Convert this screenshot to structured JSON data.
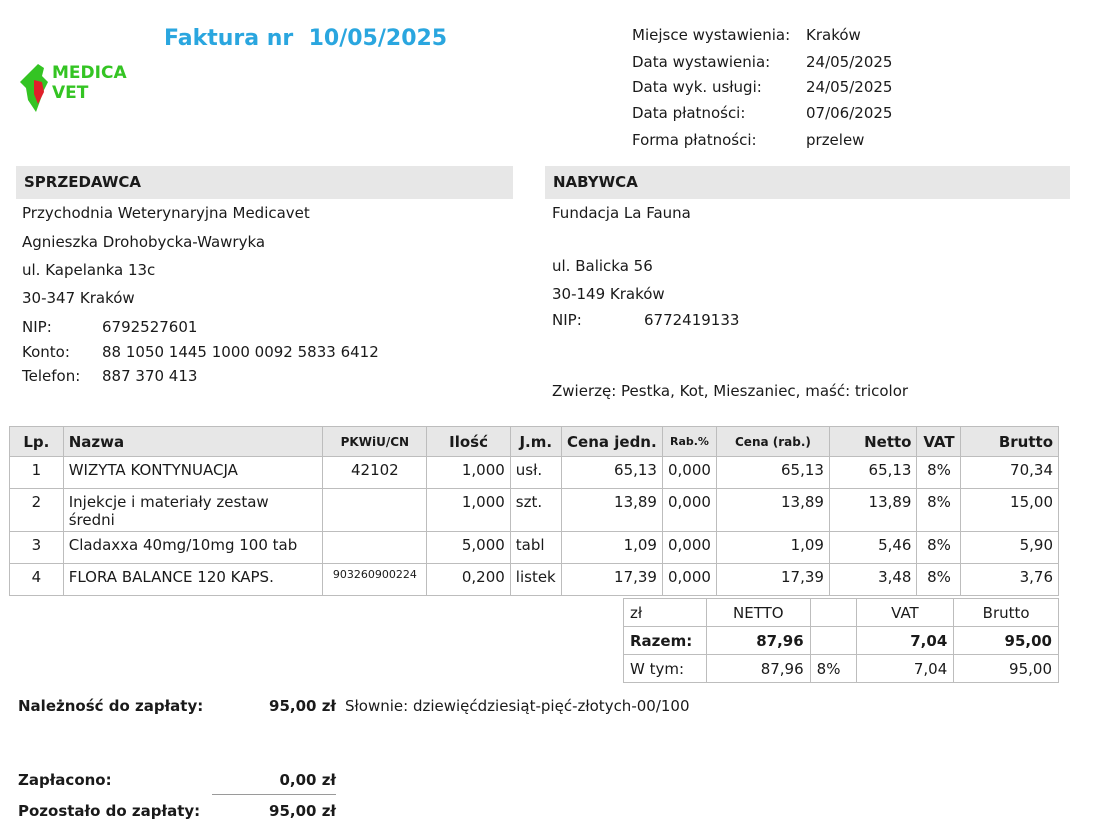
{
  "invoice": {
    "title": "Faktura nr  10/05/2025"
  },
  "logo": {
    "line1": "MEDICA",
    "line2": "VET"
  },
  "meta": [
    {
      "label": "Miejsce wystawienia:",
      "value": "Kraków"
    },
    {
      "label": "Data wystawienia:",
      "value": "24/05/2025"
    },
    {
      "label": "Data wyk. usługi:",
      "value": "24/05/2025"
    },
    {
      "label": "Data płatności:",
      "value": "07/06/2025"
    },
    {
      "label": "Forma płatności:",
      "value": "przelew"
    }
  ],
  "seller": {
    "heading": "SPRZEDAWCA",
    "name": "Przychodnia Weterynaryjna Medicavet",
    "person": "Agnieszka Drohobycka-Wawryka",
    "street": "ul. Kapelanka 13c",
    "city": "30-347 Kraków",
    "nip_label": "NIP:",
    "nip": "6792527601",
    "konto_label": "Konto:",
    "konto": "88 1050 1445 1000 0092 5833 6412",
    "tel_label": "Telefon:",
    "tel": "887 370 413"
  },
  "buyer": {
    "heading": "NABYWCA",
    "name": "Fundacja La Fauna",
    "street": "ul. Balicka 56",
    "city": "30-149 Kraków",
    "nip_label": "NIP:",
    "nip": "6772419133",
    "animal": "Zwierzę: Pestka, Kot, Mieszaniec, maść: tricolor"
  },
  "items_table": {
    "headers": [
      "Lp.",
      "Nazwa",
      "PKWiU/CN",
      "Ilość",
      "J.m.",
      "Cena jedn.",
      "Rab.%",
      "Cena (rab.)",
      "Netto",
      "VAT",
      "Brutto"
    ],
    "rows": [
      [
        "1",
        "WIZYTA KONTYNUACJA",
        "42102",
        "1,000",
        "usł.",
        "65,13",
        "0,000",
        "65,13",
        "65,13",
        "8%",
        "70,34"
      ],
      [
        "2",
        "Injekcje i materiały  zestaw średni",
        "",
        "1,000",
        "szt.",
        "13,89",
        "0,000",
        "13,89",
        "13,89",
        "8%",
        "15,00"
      ],
      [
        "3",
        "Cladaxxa 40mg/10mg 100 tab",
        "",
        "5,000",
        "tabl",
        "1,09",
        "0,000",
        "1,09",
        "5,46",
        "8%",
        "5,90"
      ],
      [
        "4",
        "FLORA BALANCE 120 KAPS.",
        "903260900224",
        "0,200",
        "listek",
        "17,39",
        "0,000",
        "17,39",
        "3,48",
        "8%",
        "3,76"
      ]
    ]
  },
  "totals": {
    "currency": "zł",
    "netto_header": "NETTO",
    "vat_header": "VAT",
    "brutto_header": "Brutto",
    "sum_label": "Razem:",
    "sum_netto": "87,96",
    "sum_vat": "7,04",
    "sum_brutto": "95,00",
    "wtym_label": "W tym:",
    "wtym_netto": "87,96",
    "wtym_rate": "8%",
    "wtym_vat": "7,04",
    "wtym_brutto": "95,00"
  },
  "payment": {
    "due_label": "Należność do zapłaty:",
    "due_value": "95,00 zł",
    "words": "Słownie: dziewięćdziesiąt-pięć-złotych-00/100",
    "paid_label": "Zapłacono:",
    "paid_value": "0,00 zł",
    "remaining_label": "Pozostało do zapłaty:",
    "remaining_value": "95,00 zł"
  },
  "colors": {
    "title": "#2aa6df",
    "logo_green": "#34c423",
    "logo_red": "#e0202a",
    "header_bg": "#e7e7e7"
  }
}
